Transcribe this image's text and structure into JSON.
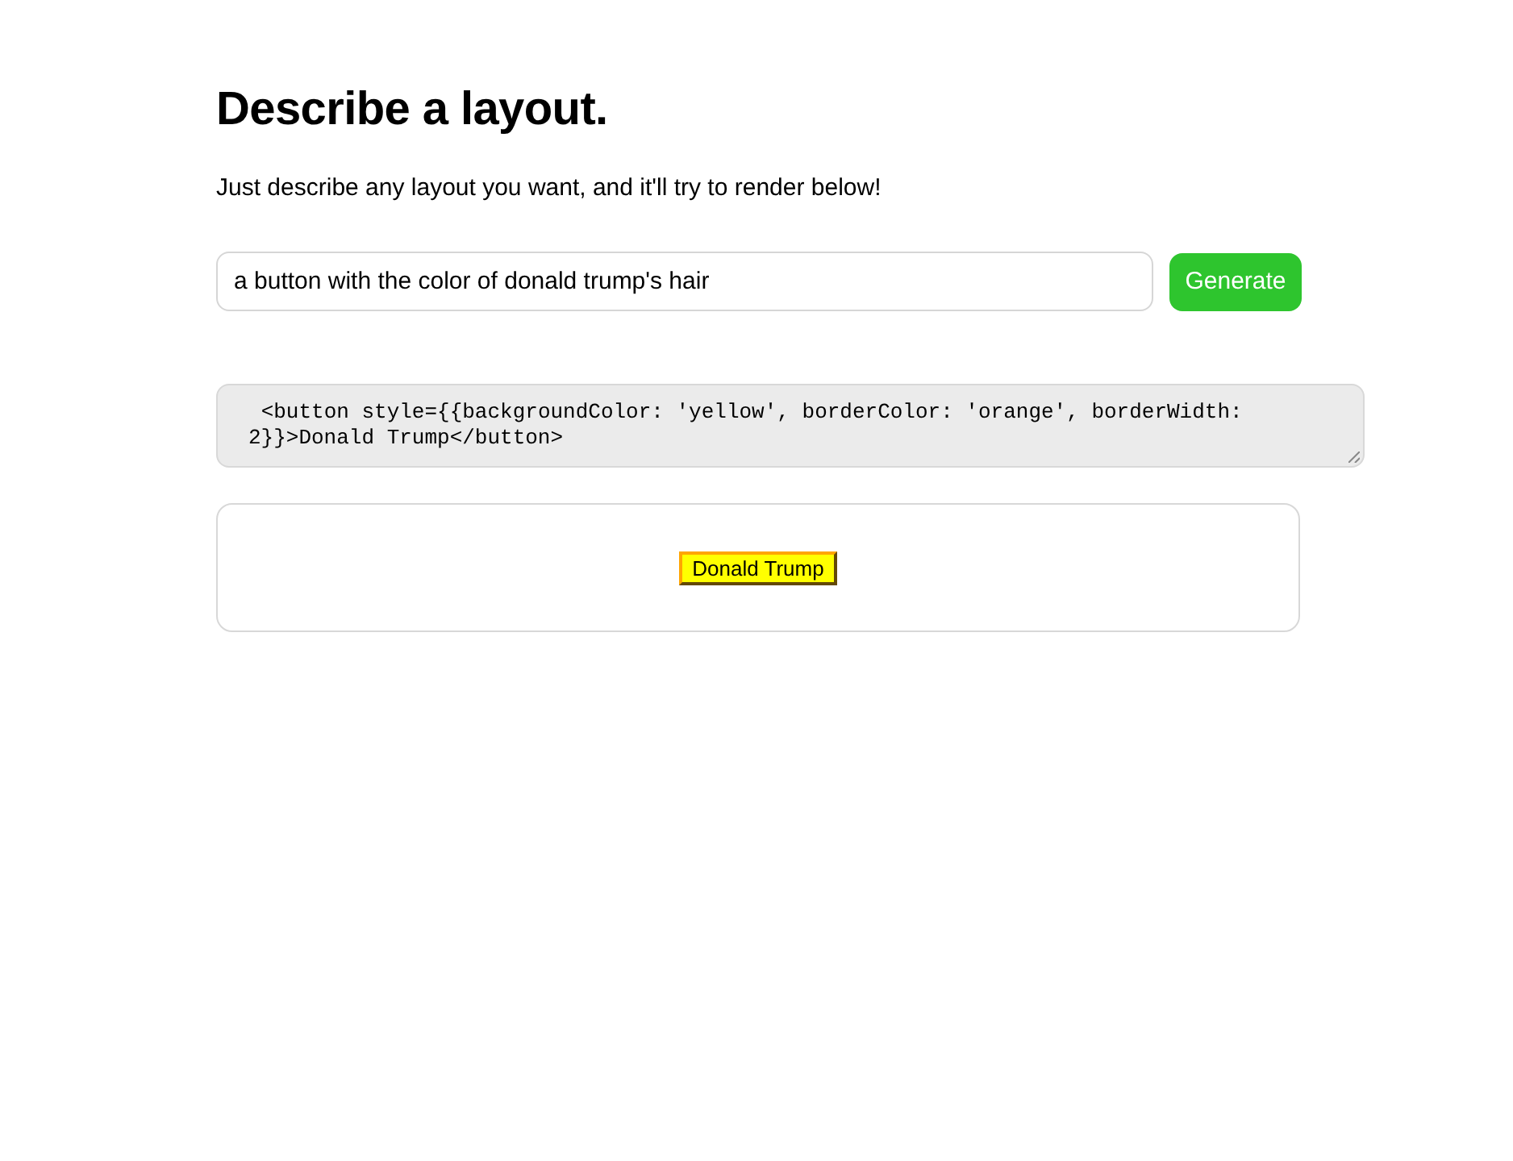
{
  "heading": "Describe a layout.",
  "intro": "Just describe any layout you want, and it'll try to render below!",
  "prompt_field": {
    "value": "a button with the color of donald trump's hair"
  },
  "generate_button": "Generate",
  "code": " <button style={{backgroundColor: 'yellow', borderColor: 'orange', borderWidth: 2}}>Donald Trump</button>",
  "preview": {
    "button": "Donald Trump"
  }
}
